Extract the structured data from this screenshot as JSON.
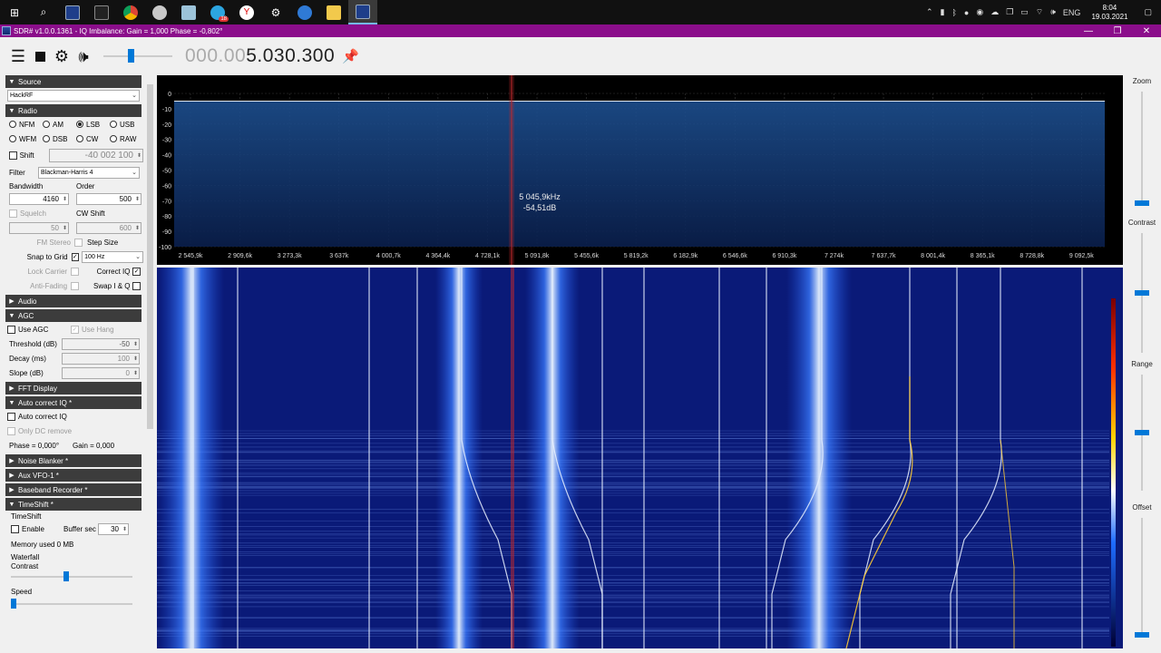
{
  "taskbar": {
    "icons": [
      "windows-start-icon",
      "search-icon",
      "sdr-app-icon",
      "terminal-icon",
      "chrome-icon",
      "app-icon",
      "notes-icon",
      "telegram-icon",
      "yandex-icon",
      "settings-icon",
      "app-icon-2",
      "folder-icon",
      "sdr-app-icon-active"
    ],
    "telegram_badge": "18",
    "tray": {
      "language": "ENG",
      "time": "8:04",
      "date": "19.03.2021"
    }
  },
  "window": {
    "title": "SDR# v1.0.0.1361 - IQ Imbalance: Gain = 1,000 Phase = -0,802°",
    "minimize": "—",
    "maximize": "❐",
    "close": "✕"
  },
  "toolbar": {
    "frequency_dim": "000.00",
    "frequency_bright": "5.030.300",
    "volume_level": 0.4
  },
  "sections": {
    "source": "Source",
    "radio": "Radio",
    "audio": "Audio",
    "agc": "AGC",
    "fft": "FFT Display",
    "auto_iq": "Auto correct IQ *",
    "noise_blanker": "Noise Blanker *",
    "aux_vfo": "Aux VFO-1 *",
    "baseband": "Baseband Recorder *",
    "timeshift": "TimeShift *"
  },
  "source": {
    "device": "HackRF"
  },
  "radio": {
    "modes": [
      "NFM",
      "AM",
      "LSB",
      "USB",
      "WFM",
      "DSB",
      "CW",
      "RAW"
    ],
    "selected_mode": "LSB",
    "shift_label": "Shift",
    "shift_value": "-40 002 100",
    "filter_label": "Filter",
    "filter_value": "Blackman-Harris 4",
    "bandwidth_label": "Bandwidth",
    "bandwidth_value": "4160",
    "order_label": "Order",
    "order_value": "500",
    "squelch_label": "Squelch",
    "squelch_value": "50",
    "cw_shift_label": "CW Shift",
    "cw_shift_value": "600",
    "fm_stereo_label": "FM Stereo",
    "step_size_label": "Step Size",
    "snap_label": "Snap to Grid",
    "step_value": "100 Hz",
    "lock_carrier_label": "Lock Carrier",
    "correct_iq_label": "Correct IQ",
    "anti_fading_label": "Anti-Fading",
    "swap_iq_label": "Swap I & Q"
  },
  "agc": {
    "use_agc": "Use AGC",
    "use_hang": "Use Hang",
    "threshold_label": "Threshold (dB)",
    "threshold_value": "-50",
    "decay_label": "Decay (ms)",
    "decay_value": "100",
    "slope_label": "Slope (dB)",
    "slope_value": "0"
  },
  "auto_iq": {
    "auto_label": "Auto correct IQ",
    "only_dc_label": "Only DC remove",
    "phase_text": "Phase = 0,000°",
    "gain_text": "Gain = 0,000"
  },
  "timeshift": {
    "group_label": "TimeShift",
    "enable_label": "Enable",
    "buffer_label": "Buffer sec",
    "buffer_value": "30",
    "memory_text": "Memory used 0 MB"
  },
  "waterfall_panel": {
    "group_label": "Waterfall",
    "contrast_label": "Contrast",
    "speed_label": "Speed",
    "contrast_level": 0.45,
    "speed_level": 0.0
  },
  "right_panel": {
    "zoom": "Zoom",
    "contrast": "Contrast",
    "range": "Range",
    "offset": "Offset",
    "zoom_level": 0.0,
    "contrast_level": 0.5,
    "range_level": 0.5,
    "offset_level": 0.0
  },
  "chart_data": {
    "type": "line",
    "ylim": [
      -100,
      0
    ],
    "y_ticks": [
      "0",
      "-10",
      "-20",
      "-30",
      "-40",
      "-50",
      "-60",
      "-70",
      "-80",
      "-90",
      "-100"
    ],
    "x_ticks": [
      "2 545,9k",
      "2 909,6k",
      "3 273,3k",
      "3 637k",
      "4 000,7k",
      "4 364,4k",
      "4 728,1k",
      "5 091,8k",
      "5 455,6k",
      "5 819,2k",
      "6 182,9k",
      "6 546,6k",
      "6 910,3k",
      "7 274k",
      "7 637,7k",
      "8 001,4k",
      "8 365,1k",
      "8 728,8k",
      "9 092,5k"
    ],
    "cursor_freq": "5 045,9kHz",
    "cursor_level": "-54,51dB",
    "grid": true,
    "colors": {
      "trace": "#ffffff",
      "fill_top": "#1d4f8f",
      "fill_bottom": "#0a1f4d",
      "cursor": "#c0282b"
    }
  }
}
